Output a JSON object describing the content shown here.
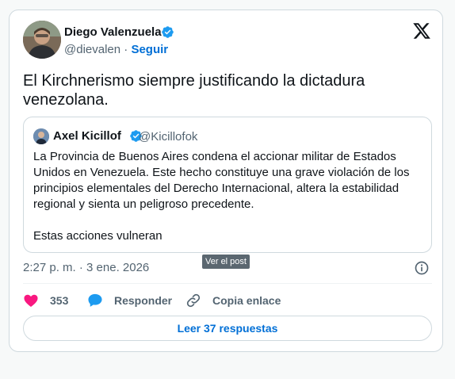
{
  "author": {
    "name": "Diego Valenzuela",
    "handle": "@dievalen",
    "separator": "·",
    "follow_label": "Seguir"
  },
  "tweet": {
    "text": "El Kirchnerismo siempre justificando la dictadura venezolana."
  },
  "quote": {
    "name": "Axel Kicillof",
    "handle": "@Kicillofok",
    "paragraph1": "La Provincia de Buenos Aires condena el accionar militar de Estados Unidos en Venezuela. Este hecho constituye una grave violación de los principios elementales del Derecho Internacional, altera la estabilidad regional y sienta un peligroso precedente.",
    "paragraph2": "Estas acciones vulneran"
  },
  "meta": {
    "timestamp": "2:27 p. m. · 3 ene. 2026",
    "tooltip": "Ver el post"
  },
  "actions": {
    "like_count": "353",
    "reply_label": "Responder",
    "copy_label": "Copia enlace"
  },
  "read_replies_label": "Leer 37 respuestas",
  "icons": {
    "verified": "verified-badge-icon",
    "x_logo": "x-logo-icon",
    "info": "info-icon",
    "like": "heart-icon",
    "reply": "speech-bubble-icon",
    "copy": "link-icon"
  },
  "colors": {
    "accent_blue": "#006fd6",
    "verified_blue": "#1d9bf0",
    "like_pink": "#f91880",
    "secondary_text": "#536471",
    "border": "#cfd9de"
  }
}
